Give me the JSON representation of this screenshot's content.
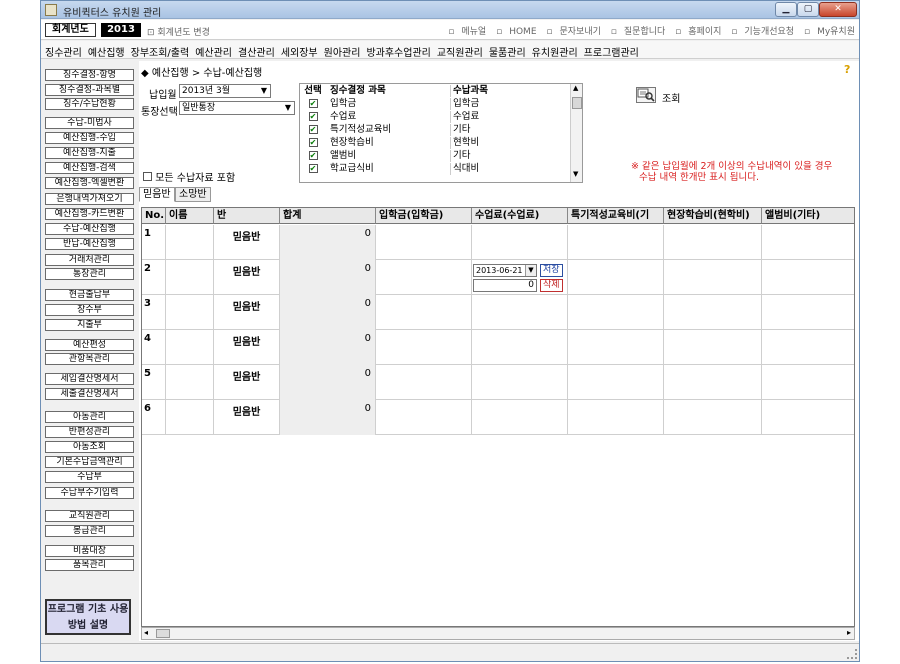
{
  "window": {
    "title": "유비퀵터스 유치원 관리"
  },
  "topbar": {
    "fiscal_label": "회계년도",
    "fiscal_year": "2013",
    "fiscal_change": "회계년도 변경",
    "links": [
      "메뉴얼",
      "HOME",
      "문자보내기",
      "질문합니다",
      "홈페이지",
      "기능개선요청",
      "My유치원"
    ]
  },
  "menu": [
    "징수관리",
    "예산집행",
    "장부조회/출력",
    "예산관리",
    "결산관리",
    "세외장부",
    "원아관리",
    "방과후수업관리",
    "교직원관리",
    "물품관리",
    "유치원관리",
    "프로그램관리"
  ],
  "sidebar": {
    "items": [
      "징수결정-항명",
      "징수결정-과목별",
      "징수/수납현황",
      "수납-미법사",
      "예산집행-수입",
      "예산집행-지출",
      "예산집행-검색",
      "예산집행-엑셀변환",
      "은행내역가져오기",
      "예산집행-카드변환",
      "수납-예산집행",
      "반납-예산집행",
      "거래처관리",
      "통장관리",
      "현금출납부",
      "장수부",
      "지출부",
      "예산편성",
      "관항목관리",
      "세입결산명세서",
      "세출결산명세서",
      "아동관리",
      "반편성관리",
      "아동조회",
      "기본수납금액관리",
      "수납부",
      "수납부수기입력",
      "교직원관리",
      "봉급관리",
      "비품대장",
      "품목관리"
    ],
    "help": "프로그램 기초 사용방법 설명"
  },
  "content": {
    "breadcrumb": "◆ 예산집행 > 수납-예산집행",
    "help_mark": "?",
    "pay_month_label": "납입월",
    "pay_month_value": "2013년 3월",
    "account_label": "통장선택",
    "account_value": "일반통장",
    "include_all_label": "모든 수납자료 포함",
    "search_label": "조회",
    "notice_line1": "※ 같은 납입월에 2개 이상의 수납내역이 있을 경우",
    "notice_line2": "수납 내역 한개만 표시 됩니다.",
    "subject_headers": {
      "sel": "선택",
      "subject": "징수결정 과목",
      "receipt": "수납과목"
    },
    "subjects": [
      {
        "subject": "입학금",
        "receipt": "입학금"
      },
      {
        "subject": "수업료",
        "receipt": "수업료"
      },
      {
        "subject": "특기적성교육비",
        "receipt": "기타"
      },
      {
        "subject": "현장학습비",
        "receipt": "현학비"
      },
      {
        "subject": "앨범비",
        "receipt": "기타"
      },
      {
        "subject": "학교급식비",
        "receipt": "식대비"
      }
    ],
    "tabs": [
      "믿음반",
      "소망반"
    ]
  },
  "grid": {
    "headers": [
      "No.",
      "이름",
      "반",
      "합계",
      "입학금(입학금)",
      "수업료(수업료)",
      "특기적성교육비(기",
      "현장학습비(현학비)",
      "앨범비(기타)"
    ],
    "rows": [
      {
        "no": "1",
        "name": "",
        "class": "믿음반",
        "total": "0"
      },
      {
        "no": "2",
        "name": "",
        "class": "믿음반",
        "total": "0"
      },
      {
        "no": "3",
        "name": "",
        "class": "믿음반",
        "total": "0"
      },
      {
        "no": "4",
        "name": "",
        "class": "믿음반",
        "total": "0"
      },
      {
        "no": "5",
        "name": "",
        "class": "믿음반",
        "total": "0"
      },
      {
        "no": "6",
        "name": "",
        "class": "믿음반",
        "total": "0"
      }
    ],
    "editor": {
      "date": "2013-06-21",
      "amount": "0",
      "save": "저장",
      "delete": "삭제"
    }
  }
}
